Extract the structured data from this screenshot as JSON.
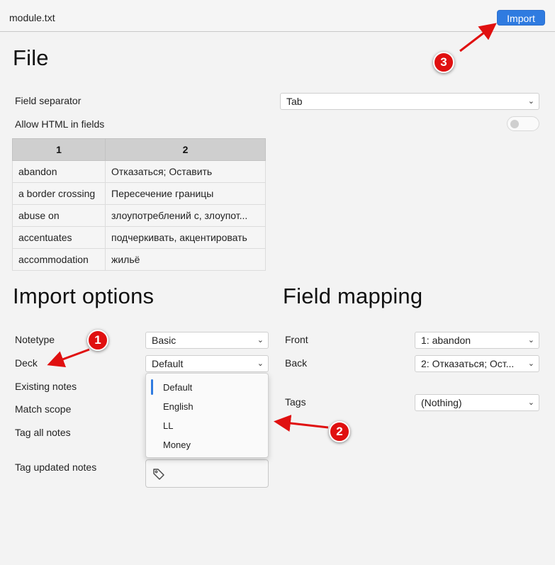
{
  "header": {
    "filename": "module.txt",
    "import_label": "Import"
  },
  "file_section": {
    "title": "File",
    "field_separator_label": "Field separator",
    "field_separator_value": "Tab",
    "allow_html_label": "Allow HTML in fields",
    "allow_html_on": false,
    "columns": [
      "1",
      "2"
    ],
    "rows": [
      [
        "abandon",
        "Отказаться; Оставить"
      ],
      [
        "a border crossing",
        "Пересечение границы"
      ],
      [
        "abuse on",
        "злоупотреблений с, злоупот..."
      ],
      [
        "accentuates",
        "подчеркивать, акцентировать"
      ],
      [
        "accommodation",
        "жильё"
      ]
    ]
  },
  "import_options": {
    "title": "Import options",
    "notetype_label": "Notetype",
    "notetype_value": "Basic",
    "deck_label": "Deck",
    "deck_value": "Default",
    "existing_notes_label": "Existing notes",
    "match_scope_label": "Match scope",
    "tag_all_label": "Tag all notes",
    "tag_updated_label": "Tag updated notes",
    "deck_options": [
      "Default",
      "English",
      "LL",
      "Money"
    ]
  },
  "field_mapping": {
    "title": "Field mapping",
    "front_label": "Front",
    "front_value": "1: abandon",
    "back_label": "Back",
    "back_value": "2: Отказаться; Ост...",
    "tags_label": "Tags",
    "tags_value": "(Nothing)"
  },
  "annotations": {
    "badges": [
      "1",
      "2",
      "3"
    ],
    "color": "#e01010"
  },
  "icons": {
    "chevron": "chevron-down-icon",
    "tag": "tag-icon"
  }
}
